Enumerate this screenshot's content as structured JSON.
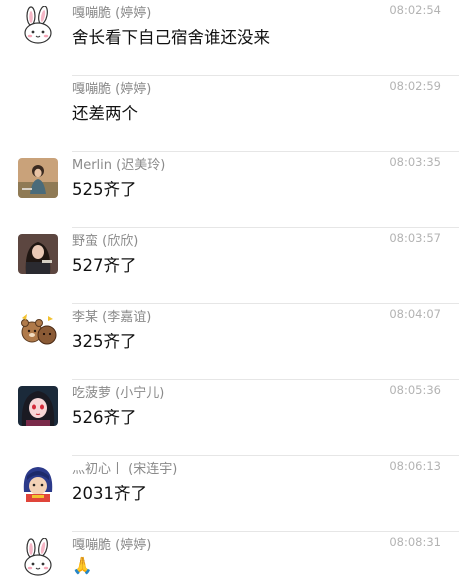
{
  "messages": [
    {
      "avatar_icon": "pink-rabbit-sticker-icon",
      "sender": "嘎嘣脆 (婷婷)",
      "time": "08:02:54",
      "text": "舍长看下自己宿舍谁还没来",
      "show_avatar": true
    },
    {
      "avatar_icon": "",
      "sender": "嘎嘣脆 (婷婷)",
      "time": "08:02:59",
      "text": "还差两个",
      "show_avatar": false
    },
    {
      "avatar_icon": "girl-photo-avatar-icon",
      "sender": "Merlin (迟美玲)",
      "time": "08:03:35",
      "text": "525齐了",
      "show_avatar": true
    },
    {
      "avatar_icon": "dark-haired-girl-photo-avatar-icon",
      "sender": "野蛮 (欣欣)",
      "time": "08:03:57",
      "text": "527齐了",
      "show_avatar": true
    },
    {
      "avatar_icon": "cartoon-bears-sticker-icon",
      "sender": "李某 (李嘉谊)",
      "time": "08:04:07",
      "text": "325齐了",
      "show_avatar": true
    },
    {
      "avatar_icon": "cartoon-girl-red-eyes-avatar-icon",
      "sender": "吃菠萝 (小宁儿)",
      "time": "08:05:36",
      "text": "526齐了",
      "show_avatar": true
    },
    {
      "avatar_icon": "anime-character-avatar-icon",
      "sender": "灬初心丨 (宋连宇)",
      "time": "08:06:13",
      "text": "2031齐了",
      "show_avatar": true
    },
    {
      "avatar_icon": "pink-rabbit-sticker-icon",
      "sender": "嘎嘣脆 (婷婷)",
      "time": "08:08:31",
      "text": "🙏",
      "show_avatar": true
    }
  ]
}
